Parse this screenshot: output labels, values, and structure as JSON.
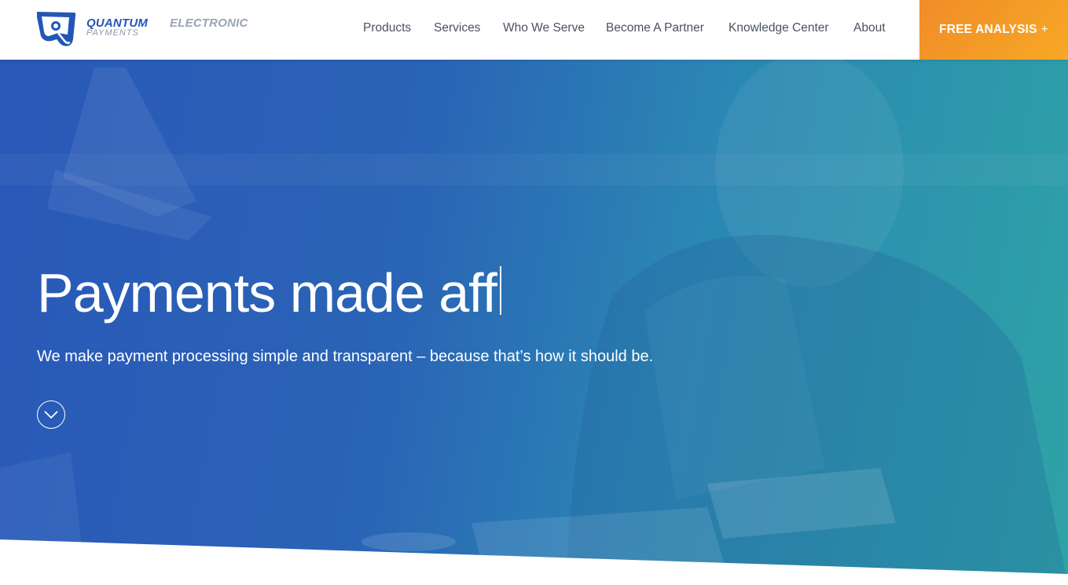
{
  "logo": {
    "word1": "QUANTUM",
    "word2": "ELECTRONIC",
    "word3": "PAYMENTS",
    "icon": "quantum-logo-mark"
  },
  "nav": {
    "items": [
      {
        "label": "Products"
      },
      {
        "label": "Services"
      },
      {
        "label": "Who We Serve"
      },
      {
        "label": "Become A Partner"
      },
      {
        "label": "Knowledge Center"
      },
      {
        "label": "About"
      }
    ]
  },
  "cta": {
    "label": "FREE ANALYSIS",
    "plus": "+",
    "color": "#f39a26"
  },
  "hero": {
    "title": "Payments made aff",
    "subtitle": "We make payment processing simple and transparent – because that’s how it should be.",
    "scroll_icon": "chevron-down-circle-icon",
    "gradient_start": "#2958b8",
    "gradient_end": "#2ea3a6"
  },
  "colors": {
    "brand_blue": "#2456b6",
    "accent_orange": "#f39a26",
    "nav_text": "#4a5260"
  }
}
